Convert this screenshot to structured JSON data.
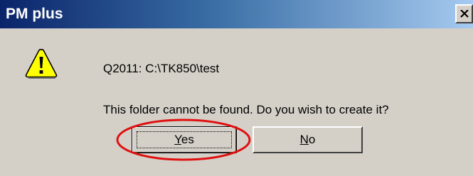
{
  "dialog": {
    "title": "PM plus",
    "close_symbol": "×",
    "icon": "warning-icon",
    "path_line": "Q2011: C:\\TK850\\test",
    "message": "This folder cannot be found. Do you wish to create it?"
  },
  "buttons": {
    "yes": {
      "accel": "Y",
      "rest": "es"
    },
    "no": {
      "accel": "N",
      "rest": "o"
    }
  },
  "annotation": {
    "type": "red-ellipse-highlight",
    "target": "yes-button",
    "color": "#e01010"
  },
  "colors": {
    "face": "#d4d0c8",
    "title_start": "#0a246a",
    "title_end": "#a6caf0",
    "warning_yellow": "#ffff00"
  }
}
